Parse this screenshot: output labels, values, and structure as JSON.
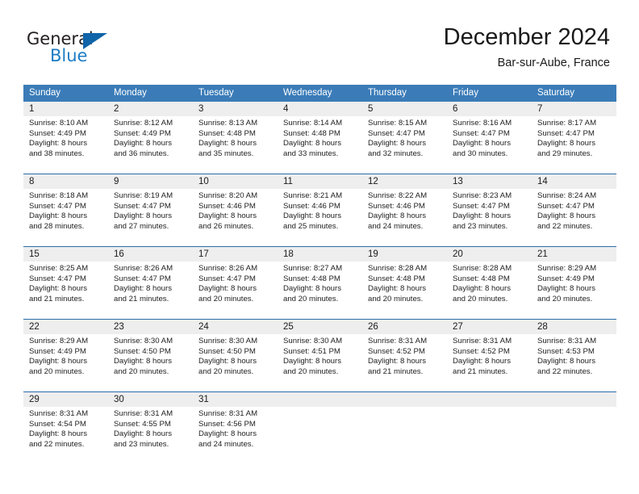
{
  "logo": {
    "word_one": "General",
    "word_two": "Blue",
    "triangle_color": "#1064a8",
    "blue_text_color": "#1c7cc4"
  },
  "header": {
    "title": "December 2024",
    "subtitle": "Bar-sur-Aube, France"
  },
  "theme": {
    "header_blue": "#3b7cb8",
    "row_divider_blue": "#2b6da9",
    "daynum_band_gray": "#eeeeee",
    "text_color": "#1a1a1a"
  },
  "weekdays": [
    "Sunday",
    "Monday",
    "Tuesday",
    "Wednesday",
    "Thursday",
    "Friday",
    "Saturday"
  ],
  "weeks": [
    [
      {
        "day": "1",
        "sunrise": "Sunrise: 8:10 AM",
        "sunset": "Sunset: 4:49 PM",
        "daylight_1": "Daylight: 8 hours",
        "daylight_2": "and 38 minutes."
      },
      {
        "day": "2",
        "sunrise": "Sunrise: 8:12 AM",
        "sunset": "Sunset: 4:49 PM",
        "daylight_1": "Daylight: 8 hours",
        "daylight_2": "and 36 minutes."
      },
      {
        "day": "3",
        "sunrise": "Sunrise: 8:13 AM",
        "sunset": "Sunset: 4:48 PM",
        "daylight_1": "Daylight: 8 hours",
        "daylight_2": "and 35 minutes."
      },
      {
        "day": "4",
        "sunrise": "Sunrise: 8:14 AM",
        "sunset": "Sunset: 4:48 PM",
        "daylight_1": "Daylight: 8 hours",
        "daylight_2": "and 33 minutes."
      },
      {
        "day": "5",
        "sunrise": "Sunrise: 8:15 AM",
        "sunset": "Sunset: 4:47 PM",
        "daylight_1": "Daylight: 8 hours",
        "daylight_2": "and 32 minutes."
      },
      {
        "day": "6",
        "sunrise": "Sunrise: 8:16 AM",
        "sunset": "Sunset: 4:47 PM",
        "daylight_1": "Daylight: 8 hours",
        "daylight_2": "and 30 minutes."
      },
      {
        "day": "7",
        "sunrise": "Sunrise: 8:17 AM",
        "sunset": "Sunset: 4:47 PM",
        "daylight_1": "Daylight: 8 hours",
        "daylight_2": "and 29 minutes."
      }
    ],
    [
      {
        "day": "8",
        "sunrise": "Sunrise: 8:18 AM",
        "sunset": "Sunset: 4:47 PM",
        "daylight_1": "Daylight: 8 hours",
        "daylight_2": "and 28 minutes."
      },
      {
        "day": "9",
        "sunrise": "Sunrise: 8:19 AM",
        "sunset": "Sunset: 4:47 PM",
        "daylight_1": "Daylight: 8 hours",
        "daylight_2": "and 27 minutes."
      },
      {
        "day": "10",
        "sunrise": "Sunrise: 8:20 AM",
        "sunset": "Sunset: 4:46 PM",
        "daylight_1": "Daylight: 8 hours",
        "daylight_2": "and 26 minutes."
      },
      {
        "day": "11",
        "sunrise": "Sunrise: 8:21 AM",
        "sunset": "Sunset: 4:46 PM",
        "daylight_1": "Daylight: 8 hours",
        "daylight_2": "and 25 minutes."
      },
      {
        "day": "12",
        "sunrise": "Sunrise: 8:22 AM",
        "sunset": "Sunset: 4:46 PM",
        "daylight_1": "Daylight: 8 hours",
        "daylight_2": "and 24 minutes."
      },
      {
        "day": "13",
        "sunrise": "Sunrise: 8:23 AM",
        "sunset": "Sunset: 4:47 PM",
        "daylight_1": "Daylight: 8 hours",
        "daylight_2": "and 23 minutes."
      },
      {
        "day": "14",
        "sunrise": "Sunrise: 8:24 AM",
        "sunset": "Sunset: 4:47 PM",
        "daylight_1": "Daylight: 8 hours",
        "daylight_2": "and 22 minutes."
      }
    ],
    [
      {
        "day": "15",
        "sunrise": "Sunrise: 8:25 AM",
        "sunset": "Sunset: 4:47 PM",
        "daylight_1": "Daylight: 8 hours",
        "daylight_2": "and 21 minutes."
      },
      {
        "day": "16",
        "sunrise": "Sunrise: 8:26 AM",
        "sunset": "Sunset: 4:47 PM",
        "daylight_1": "Daylight: 8 hours",
        "daylight_2": "and 21 minutes."
      },
      {
        "day": "17",
        "sunrise": "Sunrise: 8:26 AM",
        "sunset": "Sunset: 4:47 PM",
        "daylight_1": "Daylight: 8 hours",
        "daylight_2": "and 20 minutes."
      },
      {
        "day": "18",
        "sunrise": "Sunrise: 8:27 AM",
        "sunset": "Sunset: 4:48 PM",
        "daylight_1": "Daylight: 8 hours",
        "daylight_2": "and 20 minutes."
      },
      {
        "day": "19",
        "sunrise": "Sunrise: 8:28 AM",
        "sunset": "Sunset: 4:48 PM",
        "daylight_1": "Daylight: 8 hours",
        "daylight_2": "and 20 minutes."
      },
      {
        "day": "20",
        "sunrise": "Sunrise: 8:28 AM",
        "sunset": "Sunset: 4:48 PM",
        "daylight_1": "Daylight: 8 hours",
        "daylight_2": "and 20 minutes."
      },
      {
        "day": "21",
        "sunrise": "Sunrise: 8:29 AM",
        "sunset": "Sunset: 4:49 PM",
        "daylight_1": "Daylight: 8 hours",
        "daylight_2": "and 20 minutes."
      }
    ],
    [
      {
        "day": "22",
        "sunrise": "Sunrise: 8:29 AM",
        "sunset": "Sunset: 4:49 PM",
        "daylight_1": "Daylight: 8 hours",
        "daylight_2": "and 20 minutes."
      },
      {
        "day": "23",
        "sunrise": "Sunrise: 8:30 AM",
        "sunset": "Sunset: 4:50 PM",
        "daylight_1": "Daylight: 8 hours",
        "daylight_2": "and 20 minutes."
      },
      {
        "day": "24",
        "sunrise": "Sunrise: 8:30 AM",
        "sunset": "Sunset: 4:50 PM",
        "daylight_1": "Daylight: 8 hours",
        "daylight_2": "and 20 minutes."
      },
      {
        "day": "25",
        "sunrise": "Sunrise: 8:30 AM",
        "sunset": "Sunset: 4:51 PM",
        "daylight_1": "Daylight: 8 hours",
        "daylight_2": "and 20 minutes."
      },
      {
        "day": "26",
        "sunrise": "Sunrise: 8:31 AM",
        "sunset": "Sunset: 4:52 PM",
        "daylight_1": "Daylight: 8 hours",
        "daylight_2": "and 21 minutes."
      },
      {
        "day": "27",
        "sunrise": "Sunrise: 8:31 AM",
        "sunset": "Sunset: 4:52 PM",
        "daylight_1": "Daylight: 8 hours",
        "daylight_2": "and 21 minutes."
      },
      {
        "day": "28",
        "sunrise": "Sunrise: 8:31 AM",
        "sunset": "Sunset: 4:53 PM",
        "daylight_1": "Daylight: 8 hours",
        "daylight_2": "and 22 minutes."
      }
    ],
    [
      {
        "day": "29",
        "sunrise": "Sunrise: 8:31 AM",
        "sunset": "Sunset: 4:54 PM",
        "daylight_1": "Daylight: 8 hours",
        "daylight_2": "and 22 minutes."
      },
      {
        "day": "30",
        "sunrise": "Sunrise: 8:31 AM",
        "sunset": "Sunset: 4:55 PM",
        "daylight_1": "Daylight: 8 hours",
        "daylight_2": "and 23 minutes."
      },
      {
        "day": "31",
        "sunrise": "Sunrise: 8:31 AM",
        "sunset": "Sunset: 4:56 PM",
        "daylight_1": "Daylight: 8 hours",
        "daylight_2": "and 24 minutes."
      },
      {
        "day": "",
        "sunrise": "",
        "sunset": "",
        "daylight_1": "",
        "daylight_2": ""
      },
      {
        "day": "",
        "sunrise": "",
        "sunset": "",
        "daylight_1": "",
        "daylight_2": ""
      },
      {
        "day": "",
        "sunrise": "",
        "sunset": "",
        "daylight_1": "",
        "daylight_2": ""
      },
      {
        "day": "",
        "sunrise": "",
        "sunset": "",
        "daylight_1": "",
        "daylight_2": ""
      }
    ]
  ]
}
